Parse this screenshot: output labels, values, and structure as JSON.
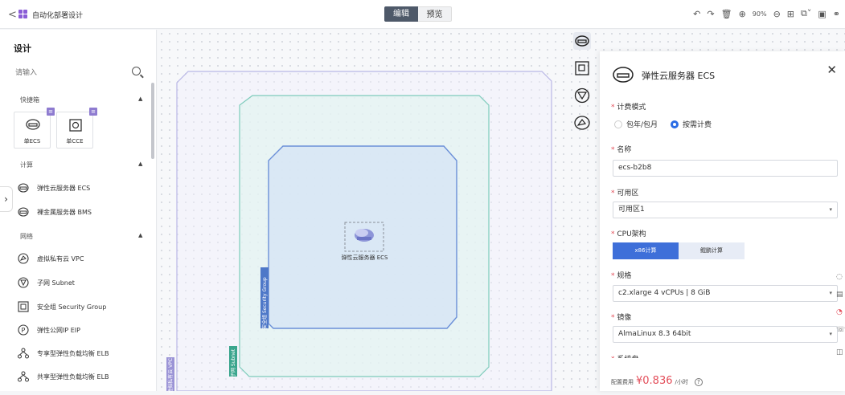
{
  "topbar": {
    "title": "自动化部署设计",
    "mode_edit": "编辑",
    "mode_preview": "预览",
    "zoom": "90%"
  },
  "sidebar": {
    "heading": "设计",
    "search_placeholder": "请输入",
    "sections": {
      "quick": "快捷箱",
      "compute": "计算",
      "network": "网络"
    },
    "quick_cards": [
      {
        "label": "单ECS",
        "badge": "≡"
      },
      {
        "label": "单CCE",
        "badge": "≡"
      }
    ],
    "compute_items": [
      {
        "label": "弹性云服务器 ECS",
        "icon": "ecs-icon"
      },
      {
        "label": "裸金属服务器 BMS",
        "icon": "bms-icon"
      }
    ],
    "network_items": [
      {
        "label": "虚拟私有云 VPC",
        "icon": "vpc-icon"
      },
      {
        "label": "子网 Subnet",
        "icon": "subnet-icon"
      },
      {
        "label": "安全组 Security Group",
        "icon": "security-group-icon"
      },
      {
        "label": "弹性公网IP EIP",
        "icon": "eip-icon"
      },
      {
        "label": "专享型弹性负载均衡 ELB",
        "icon": "elb-icon"
      },
      {
        "label": "共享型弹性负载均衡 ELB",
        "icon": "elb-icon"
      }
    ]
  },
  "canvas": {
    "node_label": "弹性云服务器 ECS",
    "vpc_tag": "虚拟私有云 VPC",
    "subnet_tag": "子网 Subnet",
    "sg_tag": "安全组 Security Group"
  },
  "panel": {
    "title": "弹性云服务器 ECS",
    "billing_label": "计费模式",
    "billing_options": [
      "包年/包月",
      "按需计费"
    ],
    "billing_selected": "按需计费",
    "name_label": "名称",
    "name_value": "ecs-b2b8",
    "az_label": "可用区",
    "az_value": "可用区1",
    "cpu_label": "CPU架构",
    "cpu_options": [
      "x86计算",
      "鲲鹏计算"
    ],
    "spec_label": "规格",
    "spec_value": "c2.xlarge   4 vCPUs | 8 GiB",
    "image_label": "镜像",
    "image_value": "AlmaLinux 8.3 64bit",
    "disk_label": "系统盘",
    "cost_label": "配置费用",
    "cost_price": "¥0.836",
    "cost_unit": "/小时",
    "help": "?"
  },
  "colors": {
    "accent": "#2b6de5",
    "price": "#e34d59",
    "vpc_border": "#b9b7e6",
    "subnet_border": "#7dcbbb",
    "sg_border": "#6a8fd8"
  }
}
